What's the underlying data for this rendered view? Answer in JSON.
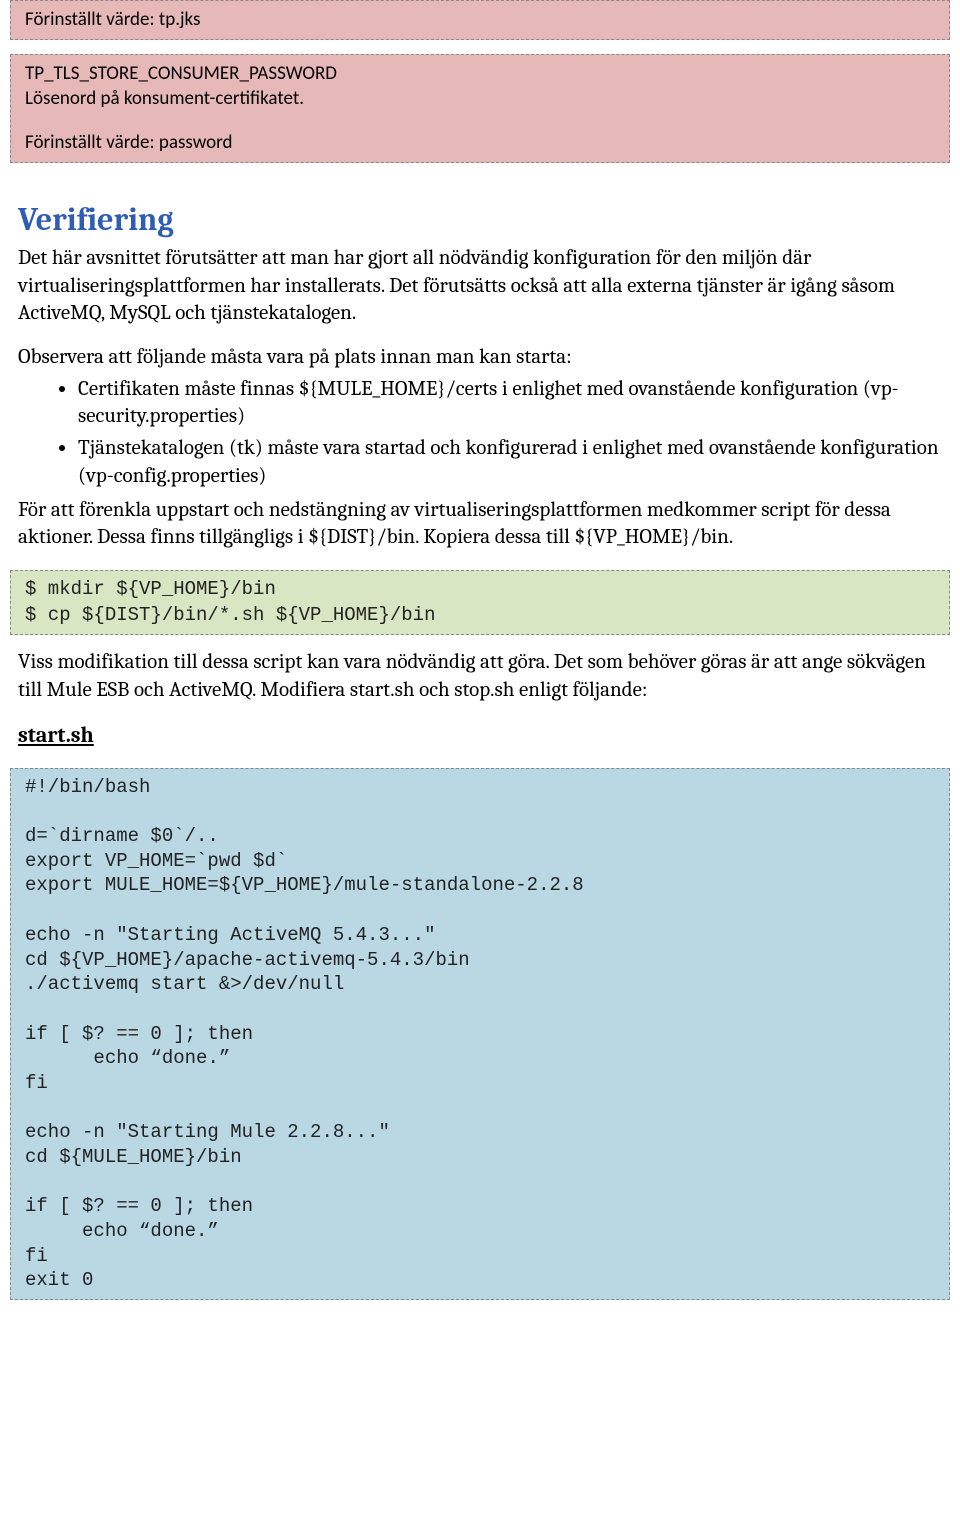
{
  "pink1": {
    "line": "Förinställt värde: tp.jks"
  },
  "pink2": {
    "line1": "TP_TLS_STORE_CONSUMER_PASSWORD",
    "line2": "Lösenord på konsument-certifikatet.",
    "line3": "Förinställt värde: password"
  },
  "heading": "Verifiering",
  "intro": "Det här avsnittet förutsätter att man har gjort all nödvändig konfiguration för den miljön där virtualiseringsplattformen har installerats. Det förutsätts också att alla externa tjänster är igång såsom ActiveMQ, MySQL och tjänstekatalogen.",
  "obs_intro": "Observera att följande måsta vara på plats innan man kan starta:",
  "bullets": {
    "b1": "Certifikaten måste finnas ${MULE_HOME}/certs i enlighet med ovanstående konfiguration (vp-security.properties)",
    "b2": "Tjänstekatalogen (tk) måste vara startad och konfigurerad i enlighet med ovanstående konfiguration (vp-config.properties)"
  },
  "after_bullets": "För att förenkla uppstart och nedstängning av virtualiseringsplattformen medkommer script för dessa aktioner. Dessa finns tillgängligs i ${DIST}/bin. Kopiera dessa till ${VP_HOME}/bin.",
  "green": "$ mkdir ${VP_HOME}/bin\n$ cp ${DIST}/bin/*.sh ${VP_HOME}/bin",
  "mid_para": "Viss modifikation till dessa script kan vara nödvändig att göra. Det som behöver göras är att ange sökvägen till Mule ESB och ActiveMQ. Modifiera start.sh och stop.sh enligt följande:",
  "startsh_label": "start.sh",
  "blue": "#!/bin/bash\n\nd=`dirname $0`/..\nexport VP_HOME=`pwd $d`\nexport MULE_HOME=${VP_HOME}/mule-standalone-2.2.8\n\necho -n \"Starting ActiveMQ 5.4.3...\"\ncd ${VP_HOME}/apache-activemq-5.4.3/bin\n./activemq start &>/dev/null\n\nif [ $? == 0 ]; then\n      echo “done.”\nfi\n\necho -n \"Starting Mule 2.2.8...\"\ncd ${MULE_HOME}/bin\n\nif [ $? == 0 ]; then\n     echo “done.”\nfi\nexit 0"
}
